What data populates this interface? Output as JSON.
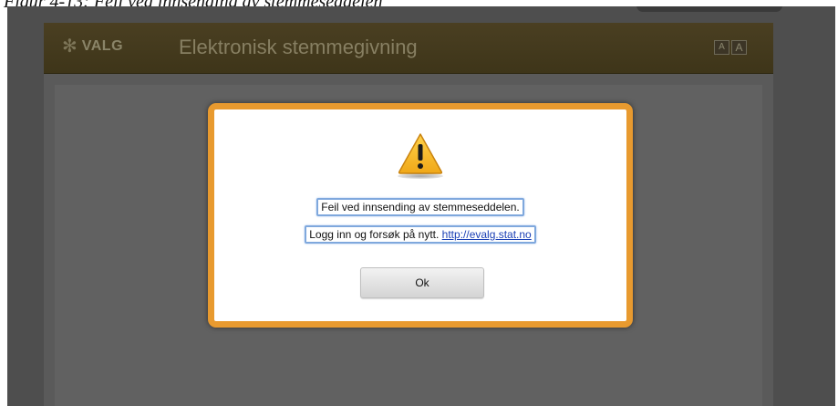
{
  "document": {
    "caption_text": "Figur 4-13: Feil ved innsending av stemmeseddelen"
  },
  "app": {
    "logo_text": "VALG",
    "logo_icon": "valg-emblem-icon",
    "title": "Elektronisk stemmegivning",
    "font_controls": {
      "small_label": "A",
      "large_label": "A"
    }
  },
  "dialog": {
    "icon": "warning-icon",
    "message": "Feil ved innsending av stemmeseddelen.",
    "instruction": "Logg inn og forsøk på nytt. ",
    "link_text": "http://evalg.stat.no",
    "ok_label": "Ok"
  },
  "colors": {
    "dialog_border": "#e89a2f",
    "header_bg": "#4a3f22",
    "overlay_bg": "#4e4e4e",
    "link": "#1a3fb5",
    "focus_outline": "#7fa8dd"
  }
}
